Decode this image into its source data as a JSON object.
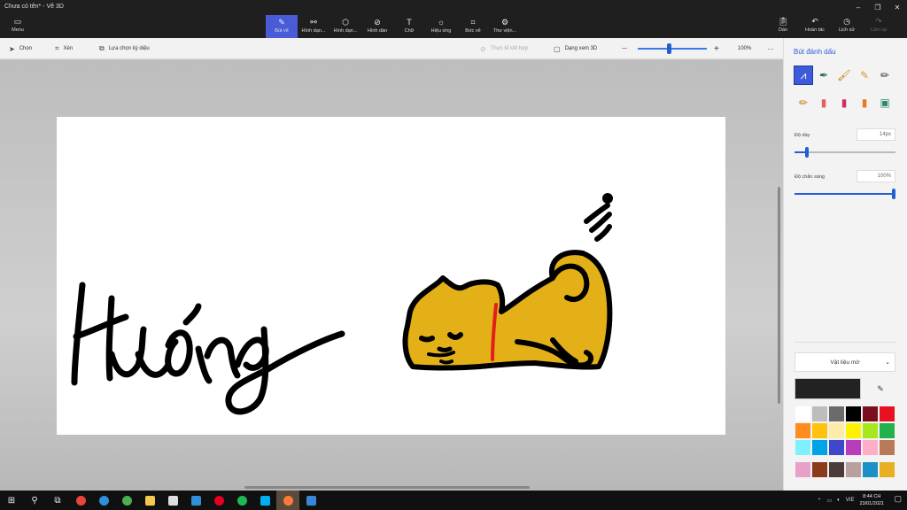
{
  "window": {
    "title": "Chưa có tên* - Vẽ 3D",
    "controls": [
      "–",
      "❐",
      "✕"
    ]
  },
  "menu": {
    "label": "Menu",
    "icon": "folder-icon"
  },
  "tools": [
    {
      "label": "Bút vẽ",
      "icon": "brush-icon",
      "active": true
    },
    {
      "label": "Hình dạn...",
      "icon": "shapes-2d-icon"
    },
    {
      "label": "Hình dạn...",
      "icon": "cube-icon"
    },
    {
      "label": "Hình dán",
      "icon": "sticker-icon"
    },
    {
      "label": "Chữ",
      "icon": "text-icon"
    },
    {
      "label": "Hiệu ứng",
      "icon": "effects-icon"
    },
    {
      "label": "Bức vẽ",
      "icon": "canvas-icon"
    },
    {
      "label": "Thư viện...",
      "icon": "library-icon"
    }
  ],
  "actions": [
    {
      "label": "Dán",
      "icon": "paste-icon"
    },
    {
      "label": "Hoàn tác",
      "icon": "undo-icon"
    },
    {
      "label": "Lịch sử",
      "icon": "history-icon"
    },
    {
      "label": "Làm lại",
      "icon": "redo-icon",
      "disabled": true
    }
  ],
  "subbar": {
    "select": "Chọn",
    "crop": "Xén",
    "magic_select": "Lựa chọn kỳ diệu",
    "mixed_reality": "Thực tế kết hợp",
    "view_3d": "Dạng xem 3D",
    "zoom_minus": "—",
    "zoom_plus": "+",
    "zoom_value": "100%",
    "zoom_level_fraction": 0.45,
    "more": "···"
  },
  "panel": {
    "title": "Bút đánh dấu",
    "brushes": [
      "marker-icon",
      "calligraphy-pen-icon",
      "oil-brush-icon",
      "watercolor-icon",
      "pixel-pen-icon",
      "pencil-icon",
      "eraser-icon",
      "crayon-icon",
      "spray-can-icon",
      "fill-icon"
    ],
    "thickness_label": "Độ dày",
    "thickness_value": "14px",
    "thickness_level": 0.12,
    "opacity_label": "Độ chắn sáng",
    "opacity_value": "100%",
    "opacity_level": 1.0,
    "material_label": "Vật liệu mờ",
    "current_color": "#222222",
    "palette": [
      "#ffffff",
      "#bdbdbd",
      "#6b6b6b",
      "#000000",
      "#7a0d1e",
      "#e81123",
      "#ff8c20",
      "#ffc20e",
      "#fdeca6",
      "#fff200",
      "#a8e61d",
      "#22b14c",
      "#7ef0ff",
      "#00a2e8",
      "#3f48cc",
      "#b83dba",
      "#ffaec9",
      "#b97a57"
    ],
    "palette_custom": [
      "#e8a0c8",
      "#8b3a1a",
      "#4b3a3a",
      "#b8a0a0",
      "#1a8fc8",
      "#e8b020"
    ]
  },
  "taskbar": {
    "apps": [
      {
        "icon": "start-icon"
      },
      {
        "icon": "search-icon"
      },
      {
        "icon": "task-view-icon"
      },
      {
        "icon": "chrome-icon",
        "color": "#e8453c"
      },
      {
        "icon": "edge-icon",
        "color": "#2f8fd8"
      },
      {
        "icon": "chrome-alt-icon",
        "color": "#4caf50"
      },
      {
        "icon": "file-explorer-icon",
        "color": "#f2c94c"
      },
      {
        "icon": "store-icon",
        "color": "#dddddd"
      },
      {
        "icon": "mail-icon",
        "color": "#2f8fd8"
      },
      {
        "icon": "pinterest-icon",
        "color": "#e60023"
      },
      {
        "icon": "spotify-icon",
        "color": "#1db954"
      },
      {
        "icon": "skype-icon",
        "color": "#00aff0"
      },
      {
        "icon": "paint3d-icon",
        "color": "#ff7a3c"
      },
      {
        "icon": "photos-icon",
        "color": "#3a86d8"
      }
    ],
    "lang": "VIE",
    "time": "8:44 CH",
    "date": "23/01/2021"
  }
}
